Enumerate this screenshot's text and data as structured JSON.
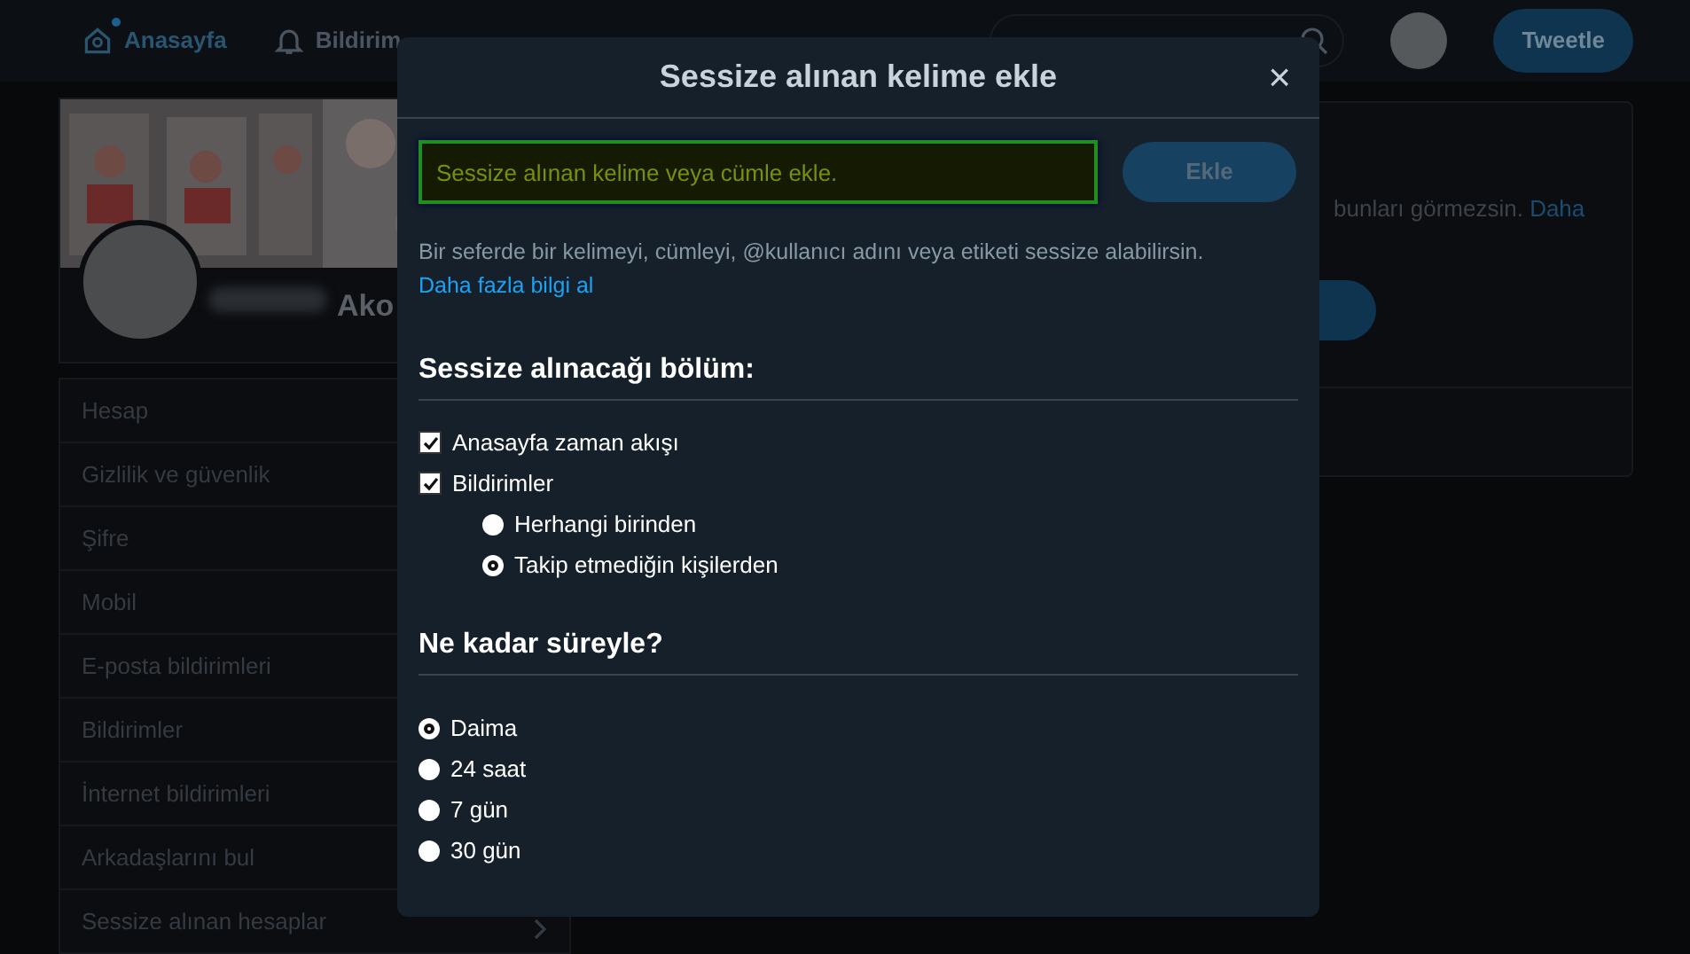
{
  "nav": {
    "items": [
      {
        "label": "Anasayfa",
        "selected": true
      },
      {
        "label": "Bildirim",
        "selected": false
      }
    ],
    "tweet_button": "Tweetle"
  },
  "profile": {
    "name": "Ako"
  },
  "settings_menu": {
    "items": [
      {
        "label": "Hesap"
      },
      {
        "label": "Gizlilik ve güvenlik"
      },
      {
        "label": "Şifre"
      },
      {
        "label": "Mobil"
      },
      {
        "label": "E-posta bildirimleri"
      },
      {
        "label": "Bildirimler"
      },
      {
        "label": "İnternet bildirimleri"
      },
      {
        "label": "Arkadaşlarını bul"
      },
      {
        "label": "Sessize alınan hesaplar"
      }
    ]
  },
  "content_card": {
    "text": "bunları görmezsin.",
    "link": "Daha"
  },
  "dialog": {
    "title": "Sessize alınan kelime ekle",
    "close": "×",
    "input": {
      "placeholder": "Sessize alınan kelime veya cümle ekle."
    },
    "add_button": {
      "label": "Ekle",
      "disabled": true
    },
    "help_text": "Bir seferde bir kelimeyi, cümleyi, @kullanıcı adını veya etiketi sessize alabilirsin.",
    "help_link": "Daha fazla bilgi al",
    "sections": [
      {
        "title": "Sessize alınacağı bölüm:",
        "options": [
          {
            "kind": "checkbox",
            "label": "Anasayfa zaman akışı",
            "checked": true
          },
          {
            "kind": "checkbox",
            "label": "Bildirimler",
            "checked": true,
            "children": [
              {
                "kind": "radio",
                "label": "Herhangi birinden",
                "selected": false
              },
              {
                "kind": "radio",
                "label": "Takip etmediğin kişilerden",
                "selected": true
              }
            ]
          }
        ]
      },
      {
        "title": "Ne kadar süreyle?",
        "options": [
          {
            "kind": "radio",
            "label": "Daima",
            "selected": true
          },
          {
            "kind": "radio",
            "label": "24 saat",
            "selected": false
          },
          {
            "kind": "radio",
            "label": "7 gün",
            "selected": false
          },
          {
            "kind": "radio",
            "label": "30 gün",
            "selected": false
          }
        ]
      }
    ]
  }
}
